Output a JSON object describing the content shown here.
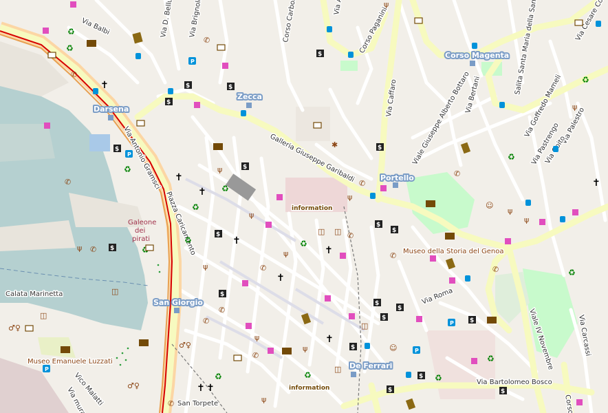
{
  "map": {
    "colors": {
      "background": "#f2efe9",
      "water": "#b5d0d0",
      "primary_road": "#fcd6a4",
      "secondary_road": "#f7fabf",
      "street": "#ffffff",
      "railway": "#d60000",
      "park": "#c8facc",
      "pedestrian": "#dddde8"
    },
    "station_labels": {
      "darsena": "Darsena",
      "zecca": "Zecca",
      "corso_magenta": "Corso Magenta",
      "portello": "Portello",
      "san_giorgio": "San Giorgio",
      "de_ferrari": "De Ferrari"
    },
    "street_labels": {
      "via_balbi": "Via Balbi",
      "via_d_bellucci": "Via D. Bellucci",
      "via_brignole": "Via Brignole D",
      "corso_carbonara": "Corso Carbonara",
      "via_a": "Via A",
      "corso_paganini": "Corso Paganini",
      "via_cesare_cortese": "Via Cesare Corte",
      "via_caffaro": "Via Caffaro",
      "salita_santa_maria": "Salita Santa Maria della Santità",
      "via_goffredo_mameli": "Via Goffredo Mameli",
      "via_bertani": "Via Bertani",
      "viale_alberto_bottaro": "Viale Giuseppe Alberto Bottaro",
      "via_pastrengo": "Via Pastrengo",
      "via_palestro": "Via Palestro",
      "via_goito": "Via Goito",
      "galleria_garibaldi": "Galleria Giuseppe Garibaldi",
      "via_antonio_gramsci": "Via Antonio Gramsci",
      "piazza_caricamento": "Piazza Caricamento",
      "via_roma": "Via Roma",
      "viale_iv_novembre": "Viale IV Novembre",
      "via_caresi": "Via Carcassi",
      "calata_marinetta": "Calata Marinetta",
      "via_malatti": "Vico Malatti",
      "via_mura_del": "Via mura del",
      "via_bartolomeo_bosco": "Via Bartolomeo Bosco",
      "san_torpete": "San Torpete",
      "corso": "Corso"
    },
    "poi_labels": {
      "galeone_dei_pirati": "Galeone\ndei\npirati",
      "museo_storia_genova": "Museo della Storia del Genoa",
      "museo_luzzati": "Museo Emanuele Luzzati",
      "information_1": "information",
      "information_2": "information"
    },
    "icons": [
      "pharmacy-icon",
      "recycling-icon",
      "post-office-icon",
      "museum-icon",
      "bus-stop-icon",
      "place-of-worship-icon",
      "bank-icon",
      "parking-icon",
      "cafe-icon",
      "restaurant-icon",
      "toilets-icon",
      "telephone-icon",
      "theatre-icon",
      "information-icon",
      "drinking-water-icon"
    ]
  }
}
